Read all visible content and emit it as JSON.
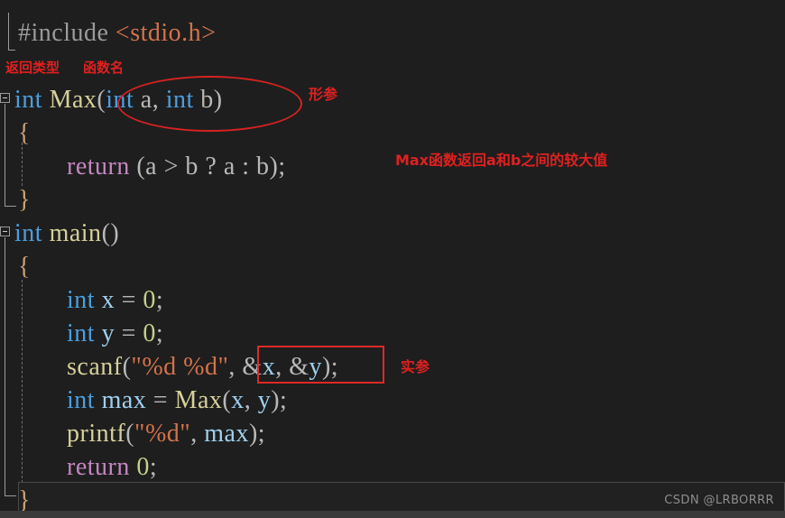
{
  "editor": {
    "background": "#1e1e1e",
    "current_line_highlight": "#212121"
  },
  "code_lines": [
    {
      "id": "include",
      "tokens": [
        {
          "text": "#include ",
          "kind": "pre"
        },
        {
          "text": "<stdio.h>",
          "kind": "hdr"
        }
      ]
    },
    {
      "id": "max-signature",
      "tokens": [
        {
          "text": "int",
          "kind": "kw"
        },
        {
          "text": " ",
          "kind": "plain"
        },
        {
          "text": "Max",
          "kind": "fn"
        },
        {
          "text": "(",
          "kind": "plain"
        },
        {
          "text": "int",
          "kind": "kw"
        },
        {
          "text": " a, ",
          "kind": "plain"
        },
        {
          "text": "int",
          "kind": "kw"
        },
        {
          "text": " b)",
          "kind": "plain"
        }
      ]
    },
    {
      "id": "max-open-brace",
      "tokens": [
        {
          "text": "{",
          "kind": "brace"
        }
      ]
    },
    {
      "id": "max-return",
      "tokens": [
        {
          "text": "return",
          "kind": "ret"
        },
        {
          "text": " (a > b ? a : b);",
          "kind": "plain"
        }
      ]
    },
    {
      "id": "max-close-brace",
      "tokens": [
        {
          "text": "}",
          "kind": "brace"
        }
      ]
    },
    {
      "id": "main-signature",
      "tokens": [
        {
          "text": "int",
          "kind": "kw"
        },
        {
          "text": " ",
          "kind": "plain"
        },
        {
          "text": "main",
          "kind": "fn"
        },
        {
          "text": "()",
          "kind": "plain"
        }
      ]
    },
    {
      "id": "main-open-brace",
      "tokens": [
        {
          "text": "{",
          "kind": "brace"
        }
      ]
    },
    {
      "id": "decl-x",
      "tokens": [
        {
          "text": "int",
          "kind": "kw"
        },
        {
          "text": " ",
          "kind": "plain"
        },
        {
          "text": "x",
          "kind": "var"
        },
        {
          "text": " = ",
          "kind": "plain"
        },
        {
          "text": "0",
          "kind": "num"
        },
        {
          "text": ";",
          "kind": "plain"
        }
      ]
    },
    {
      "id": "decl-y",
      "tokens": [
        {
          "text": "int",
          "kind": "kw"
        },
        {
          "text": " ",
          "kind": "plain"
        },
        {
          "text": "y",
          "kind": "var"
        },
        {
          "text": " = ",
          "kind": "plain"
        },
        {
          "text": "0",
          "kind": "num"
        },
        {
          "text": ";",
          "kind": "plain"
        }
      ]
    },
    {
      "id": "scanf-call",
      "tokens": [
        {
          "text": "scanf",
          "kind": "fn"
        },
        {
          "text": "(",
          "kind": "plain"
        },
        {
          "text": "\"%d %d\"",
          "kind": "str"
        },
        {
          "text": ", ",
          "kind": "plain"
        },
        {
          "text": "&",
          "kind": "plain"
        },
        {
          "text": "x",
          "kind": "var"
        },
        {
          "text": ", ",
          "kind": "plain"
        },
        {
          "text": "&",
          "kind": "plain"
        },
        {
          "text": "y",
          "kind": "var"
        },
        {
          "text": ");",
          "kind": "plain"
        }
      ]
    },
    {
      "id": "decl-max",
      "tokens": [
        {
          "text": "int",
          "kind": "kw"
        },
        {
          "text": " ",
          "kind": "plain"
        },
        {
          "text": "max",
          "kind": "var"
        },
        {
          "text": " = ",
          "kind": "plain"
        },
        {
          "text": "Max",
          "kind": "fn"
        },
        {
          "text": "(",
          "kind": "plain"
        },
        {
          "text": "x",
          "kind": "var"
        },
        {
          "text": ", ",
          "kind": "plain"
        },
        {
          "text": "y",
          "kind": "var"
        },
        {
          "text": ");",
          "kind": "plain"
        }
      ]
    },
    {
      "id": "printf-call",
      "tokens": [
        {
          "text": "printf",
          "kind": "fn"
        },
        {
          "text": "(",
          "kind": "plain"
        },
        {
          "text": "\"%d\"",
          "kind": "str"
        },
        {
          "text": ", ",
          "kind": "plain"
        },
        {
          "text": "max",
          "kind": "var"
        },
        {
          "text": ");",
          "kind": "plain"
        }
      ]
    },
    {
      "id": "main-return",
      "tokens": [
        {
          "text": "return",
          "kind": "ret"
        },
        {
          "text": " ",
          "kind": "plain"
        },
        {
          "text": "0",
          "kind": "num"
        },
        {
          "text": ";",
          "kind": "plain"
        }
      ]
    },
    {
      "id": "main-close-brace",
      "tokens": [
        {
          "text": "}",
          "kind": "brace"
        }
      ]
    }
  ],
  "annotations": {
    "color": "#e02020",
    "return_type": "返回类型",
    "function_name": "函数名",
    "formal_params": "形参",
    "max_description": "Max函数返回a和b之间的较大值",
    "actual_params": "实参"
  },
  "watermark": {
    "text": "CSDN @LRBORRR"
  }
}
